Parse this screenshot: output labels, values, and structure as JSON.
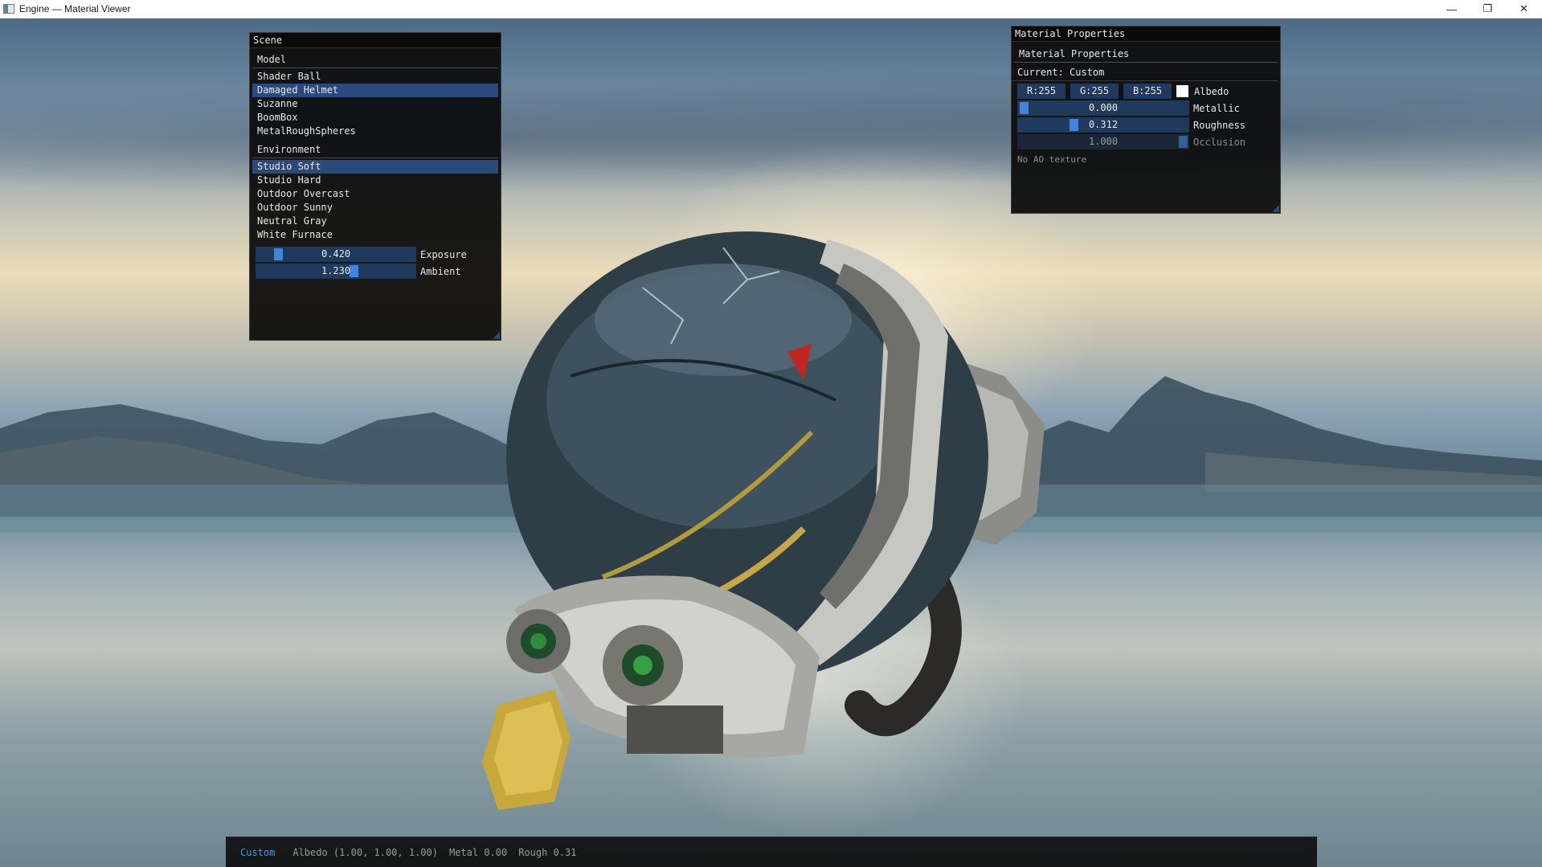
{
  "window": {
    "title": "Engine — Material Viewer",
    "controls": {
      "minimize": "—",
      "restore": "❐",
      "close": "✕"
    }
  },
  "scene_panel": {
    "title": "Scene",
    "model_header": "Model",
    "models": [
      "Shader Ball",
      "Damaged Helmet",
      "Suzanne",
      "BoomBox",
      "MetalRoughSpheres"
    ],
    "selected_model": "Damaged Helmet",
    "environment_header": "Environment",
    "environments": [
      "Studio Soft",
      "Studio Hard",
      "Outdoor Overcast",
      "Outdoor Sunny",
      "Neutral Gray",
      "White Furnace"
    ],
    "selected_environment": "Studio Soft",
    "exposure": {
      "value": "0.420",
      "label": "Exposure",
      "fraction": 0.11
    },
    "ambient": {
      "value": "1.230",
      "label": "Ambient",
      "fraction": 0.62
    }
  },
  "material_panel": {
    "title": "Material Properties",
    "header": "Material Properties",
    "current": "Current: Custom",
    "albedo": {
      "r": "R:255",
      "g": "G:255",
      "b": "B:255",
      "label": "Albedo",
      "color": "#ffffff"
    },
    "metallic": {
      "value": "0.000",
      "label": "Metallic",
      "fraction": 0.0
    },
    "roughness": {
      "value": "0.312",
      "label": "Roughness",
      "fraction": 0.312
    },
    "occlusion": {
      "value": "1.000",
      "label": "Occlusion",
      "fraction": 1.0
    },
    "ao_note": "No AO texture"
  },
  "status_bar": {
    "preset": "Custom",
    "albedo": "Albedo (1.00, 1.00, 1.00)",
    "metal": "Metal 0.00",
    "rough": "Rough 0.31"
  },
  "colors": {
    "accent": "#3d85e0",
    "selection": "#294a7a",
    "slider_bg": "#1f3a5c",
    "panel_bg": "#0c0c0c"
  }
}
